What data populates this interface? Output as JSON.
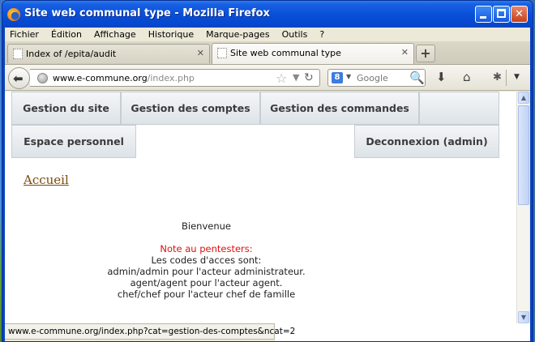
{
  "window": {
    "title": "Site web communal type",
    "app": "Mozilla Firefox",
    "full_title": "Site web communal type - Mozilla Firefox"
  },
  "menu": [
    "Fichier",
    "Édition",
    "Affichage",
    "Historique",
    "Marque-pages",
    "Outils",
    "?"
  ],
  "tabs": [
    {
      "label": "Index of /epita/audit",
      "active": false
    },
    {
      "label": "Site web communal type",
      "active": true
    }
  ],
  "address": {
    "host": "www.e-commune.org",
    "path": "/index.php"
  },
  "search": {
    "placeholder": "Google"
  },
  "site_nav": {
    "gestion_site": "Gestion du site",
    "gestion_comptes": "Gestion des comptes",
    "gestion_commandes": "Gestion des commandes",
    "espace_perso": "Espace personnel",
    "deconnexion": "Deconnexion (admin)"
  },
  "breadcrumb": "Accueil",
  "content": {
    "welcome": "Bienvenue",
    "note": "Note au pentesters:",
    "line1": "Les codes d'acces sont:",
    "line2": "admin/admin pour l'acteur administrateur.",
    "line3": "agent/agent pour l'acteur agent.",
    "line4": "chef/chef pour l'acteur chef de famille"
  },
  "status_url": "www.e-commune.org/index.php?cat=gestion-des-comptes&ncat=2",
  "colors": {
    "titlebar": "#0a4fd8",
    "note": "#dd1111",
    "link": "#7a4a0a"
  }
}
